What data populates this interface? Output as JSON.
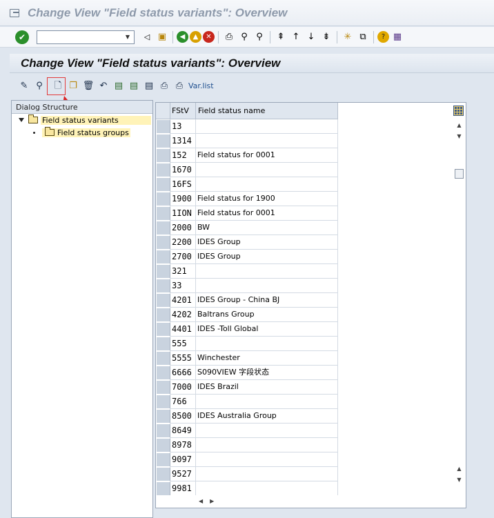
{
  "window": {
    "title": "Change View \"Field status variants\": Overview"
  },
  "std_toolbar": {
    "command_value": "",
    "icons": [
      "enter-icon",
      "back-icon",
      "save-icon",
      "back-green-icon",
      "exit-yellow-icon",
      "cancel-red-icon",
      "print-icon",
      "find-icon",
      "find-next-icon",
      "first-page-icon",
      "prev-page-icon",
      "next-page-icon",
      "last-page-icon",
      "new-session-icon",
      "shortcut-icon",
      "help-icon",
      "customize-icon"
    ]
  },
  "app_title": "Change View \"Field status variants\": Overview",
  "app_toolbar": {
    "var_list_label": "Var.list"
  },
  "dialog": {
    "header": "Dialog Structure",
    "items": [
      {
        "label": "Field status variants",
        "selected": false
      },
      {
        "label": "Field status groups",
        "selected": true
      }
    ]
  },
  "table": {
    "columns": [
      "FStV",
      "Field status name"
    ],
    "rows": [
      {
        "fstv": "13",
        "name": ""
      },
      {
        "fstv": "1314",
        "name": ""
      },
      {
        "fstv": "152",
        "name": "Field status for 0001"
      },
      {
        "fstv": "1670",
        "name": ""
      },
      {
        "fstv": "16FS",
        "name": ""
      },
      {
        "fstv": "1900",
        "name": "Field status for 1900"
      },
      {
        "fstv": "1ION",
        "name": "Field status for 0001"
      },
      {
        "fstv": "2000",
        "name": "BW"
      },
      {
        "fstv": "2200",
        "name": "IDES Group"
      },
      {
        "fstv": "2700",
        "name": "IDES Group"
      },
      {
        "fstv": "321",
        "name": ""
      },
      {
        "fstv": "33",
        "name": ""
      },
      {
        "fstv": "4201",
        "name": "IDES Group - China BJ"
      },
      {
        "fstv": "4202",
        "name": "Baltrans Group"
      },
      {
        "fstv": "4401",
        "name": " IDES -Toll Global"
      },
      {
        "fstv": "555",
        "name": ""
      },
      {
        "fstv": "5555",
        "name": "Winchester"
      },
      {
        "fstv": "6666",
        "name": "S090VIEW 字段状态"
      },
      {
        "fstv": "7000",
        "name": "IDES Brazil"
      },
      {
        "fstv": "766",
        "name": ""
      },
      {
        "fstv": "8500",
        "name": "IDES Australia Group"
      },
      {
        "fstv": "8649",
        "name": ""
      },
      {
        "fstv": "8978",
        "name": ""
      },
      {
        "fstv": "9097",
        "name": ""
      },
      {
        "fstv": "9527",
        "name": ""
      },
      {
        "fstv": "9981",
        "name": ""
      }
    ]
  },
  "accent": {
    "highlight": "#e23a3a",
    "selection": "#fff3b8"
  }
}
